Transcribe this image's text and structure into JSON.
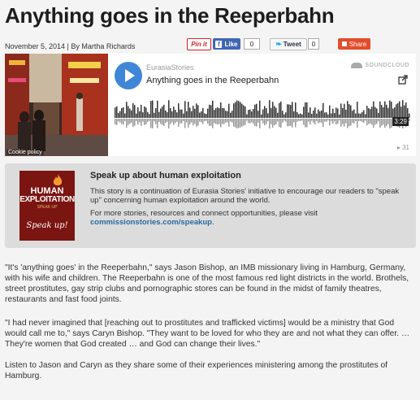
{
  "article": {
    "title": "Anything goes in the Reeperbahn",
    "byline": "November 5, 2014 | By Martha Richards"
  },
  "share_bar": {
    "pinterest_label": "Pin it",
    "like_label": "Like",
    "like_count": "0",
    "tweet_label": "Tweet",
    "tweet_count": "0",
    "share_label": "Share"
  },
  "player": {
    "user": "EurasiaStories",
    "track_title": "Anything goes in the Reeperbahn",
    "brand": "SOUNDCLOUD",
    "duration": "3:29",
    "plays": "31",
    "cover_caption": "Cookie policy",
    "icons": [
      "play-icon",
      "soundcloud-logo-icon",
      "share-icon",
      "play-count-icon"
    ]
  },
  "banner": {
    "ad_line1": "HUMAN",
    "ad_line2": "EXPLOITATION",
    "ad_line3": "SPEAK UP",
    "ad_line4": "Speak up!",
    "heading": "Speak up about human exploitation",
    "text1": "This story is a continuation of Eurasia Stories' initiative to encourage our readers to \"speak up\" concerning human exploitation around the world.",
    "text2": "For more stories, resources and connect opportunities, please visit",
    "link": "commissionstories.com/speakup",
    "link_suffix": "."
  },
  "body": {
    "p1": "\"It's 'anything goes' in the Reeperbahn,\" says Jason Bishop, an IMB missionary living in Hamburg, Germany, with his wife and children. The Reeperbahn is one of the most famous red light districts in the world. Brothels, street prostitutes, gay strip clubs and pornographic stores can be found in the midst of family theatres, restaurants and fast food joints.",
    "p2": "\"I had never imagined that [reaching out to prostitutes and trafficked victims] would be a ministry that God would call me to,\" says Caryn Bishop. \"They want to be loved for who they are and not what they can offer. … They're women that God created … and God can change their lives.\"",
    "p3": "Listen to Jason and Caryn as they share some of their experiences ministering among the prostitutes of Hamburg."
  },
  "colors": {
    "play_button": "#3f86d8",
    "like_button": "#4267b2",
    "share_button": "#e34d2b",
    "banner_bg": "#dcdcdc",
    "link": "#2a6aa0"
  }
}
